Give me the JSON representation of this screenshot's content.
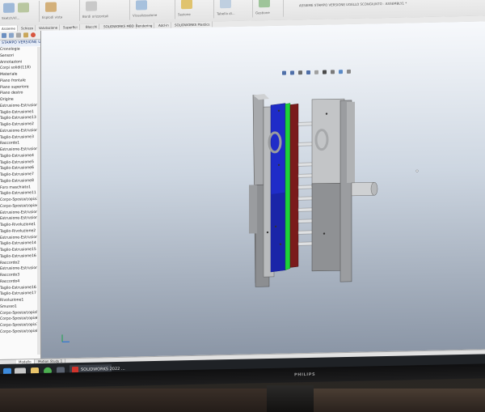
{
  "ribbon": {
    "labels": [
      "Sketch/Vi...",
      "Esplodi vista",
      "Bordi orizzontali",
      "Visualizzazione",
      "Sezione",
      "Tabella di...",
      "Gestione"
    ],
    "doc_title": "ASSIEME STAMPO VERSIONE UGELLO SCONGIUNTO - ASSEMBLY1 *"
  },
  "tabs": [
    "Assieme",
    "Schizzo",
    "Valutazione",
    "Superfici",
    "Blocchi",
    "SOLIDWORKS MBD",
    "Rendering",
    "Add-in",
    "SOLIDWORKS Plastics"
  ],
  "feature_tree": {
    "root": "STAMPO VERSIONE UG",
    "items": [
      "Cronologia",
      "Sensori",
      "Annotazioni",
      "Corpi solidi(118)",
      "Materiale",
      "Piano frontale",
      "Piano superiore",
      "Piano destro",
      "Origine",
      "Estrusione-Estrusione1",
      "Taglio-Estrusione1",
      "Taglio-Estrusione13",
      "Taglio-Estrusione2",
      "Estrusione-Estrusione2",
      "Taglio-Estrusione3",
      "Raccordo1",
      "Estrusione-Estrusione4",
      "Taglio-Estrusione4",
      "Taglio-Estrusione5",
      "Taglio-Estrusione6",
      "Taglio-Estrusione7",
      "Taglio-Estrusione8",
      "Foro maschiato1",
      "Taglio-Estrusione11",
      "Corpo-Sposta/copia3",
      "Corpo-Sposta/copia4",
      "Estrusione-Estrusione5",
      "Estrusione-Estrusione6",
      "Taglio-Rivoluzione1",
      "Taglio-Rivoluzione2",
      "Estrusione-Estrusione7",
      "Taglio-Estrusione14",
      "Taglio-Estrusione15",
      "Taglio-Estrusione16",
      "Raccordo2",
      "Estrusione-Estrusione8",
      "Raccordo3",
      "Raccordo4",
      "Taglio-Estrusione16",
      "Taglio-Estrusione17",
      "Rivoluzione1",
      "Smusso1",
      "Corpo-Sposta/copia5",
      "Corpo-Sposta/copia6",
      "Corpo-Sposta/copia7",
      "Corpo-Sposta/copia8"
    ]
  },
  "bottom_tabs": [
    "Modello",
    "Motion Study 1"
  ],
  "taskbar": {
    "app_label": "SOLIDWORKS 2022 ..."
  },
  "monitor": {
    "brand": "PHILIPS"
  }
}
